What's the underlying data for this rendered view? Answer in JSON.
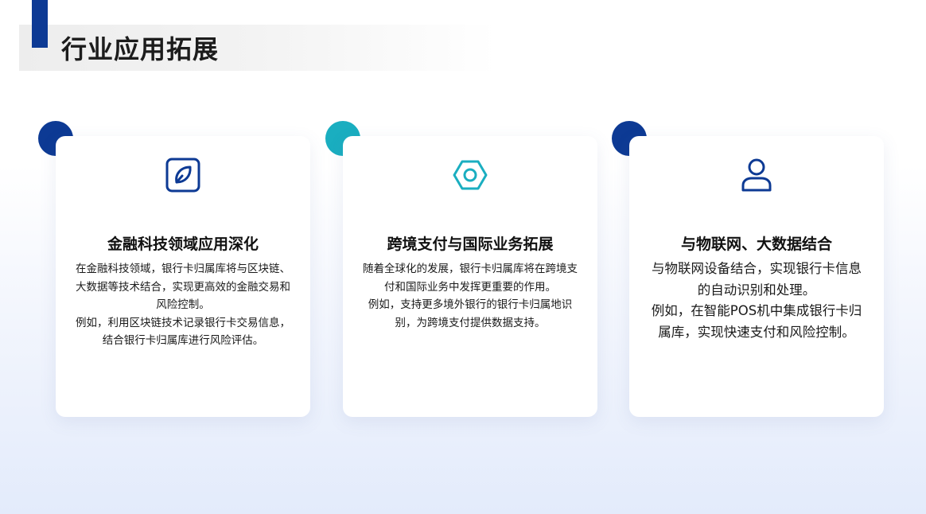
{
  "page": {
    "title": "行业应用拓展"
  },
  "colors": {
    "accent_dark_blue": "#0d3a94",
    "accent_teal": "#1aaec0",
    "text_dark": "#111111"
  },
  "cards": [
    {
      "icon": "leaf-icon",
      "icon_color": "#0d3a94",
      "circle_color": "#0d3a94",
      "title": "金融科技领域应用深化",
      "paragraphs": [
        "在金融科技领域，银行卡归属库将与区块链、大数据等技术结合，实现更高效的金融交易和风险控制。",
        "例如，利用区块链技术记录银行卡交易信息，结合银行卡归属库进行风险评估。"
      ]
    },
    {
      "icon": "hex-nut-icon",
      "icon_color": "#1aaec0",
      "circle_color": "#1aaec0",
      "title": "跨境支付与国际业务拓展",
      "paragraphs": [
        "随着全球化的发展，银行卡归属库将在跨境支付和国际业务中发挥更重要的作用。",
        "例如，支持更多境外银行的银行卡归属地识别，为跨境支付提供数据支持。"
      ]
    },
    {
      "icon": "user-icon",
      "icon_color": "#0d3a94",
      "circle_color": "#0d3a94",
      "title": "与物联网、大数据结合",
      "paragraphs": [
        "与物联网设备结合，实现银行卡信息的自动识别和处理。",
        "例如，在智能POS机中集成银行卡归属库，实现快速支付和风险控制。"
      ]
    }
  ]
}
